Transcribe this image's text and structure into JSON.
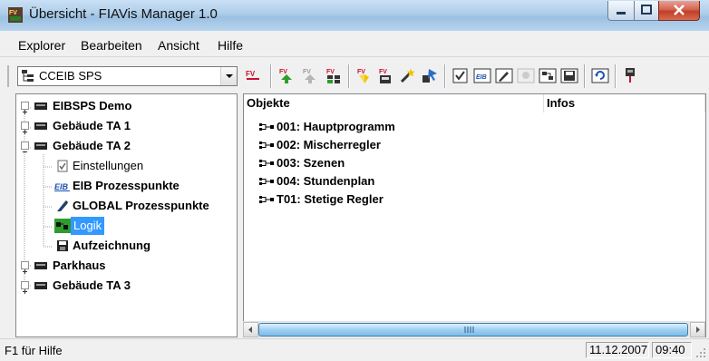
{
  "window": {
    "title": "Übersicht - FIAVis Manager 1.0"
  },
  "menu": {
    "items": [
      {
        "label": "Explorer"
      },
      {
        "label": "Bearbeiten"
      },
      {
        "label": "Ansicht"
      },
      {
        "label": "Hilfe"
      }
    ]
  },
  "toolbar": {
    "combo_value": "CCEIB SPS",
    "icons": [
      "fv-icon",
      "fv-green-arrow-icon",
      "fv-gray-arrow-icon",
      "fv-grid-icon",
      "fv-yellow-icon",
      "fv-pen-icon",
      "wand-icon",
      "pointer-icon",
      "checkbox-icon",
      "eib-icon",
      "pen-square-icon",
      "disabled-icon",
      "logic-block-icon",
      "disk-icon",
      "refresh-icon",
      "plug-icon"
    ]
  },
  "tree": {
    "nodes": [
      {
        "label": "EIBSPS Demo"
      },
      {
        "label": "Gebäude TA 1"
      },
      {
        "label": "Gebäude TA 2"
      },
      {
        "label": "Einstellungen"
      },
      {
        "label": "EIB Prozesspunkte"
      },
      {
        "label": "GLOBAL Prozesspunkte"
      },
      {
        "label": "Logik"
      },
      {
        "label": "Aufzeichnung"
      },
      {
        "label": "Parkhaus"
      },
      {
        "label": "Gebäude TA 3"
      }
    ]
  },
  "list": {
    "columns": [
      {
        "label": "Objekte"
      },
      {
        "label": "Infos"
      }
    ],
    "rows": [
      {
        "label": "001: Hauptprogramm"
      },
      {
        "label": "002: Mischerregler"
      },
      {
        "label": "003: Szenen"
      },
      {
        "label": "004: Stundenplan"
      },
      {
        "label": "T01: Stetige Regler"
      }
    ]
  },
  "status": {
    "help": "F1 für Hilfe",
    "date": "11.12.2007",
    "time": "09:40"
  },
  "colors": {
    "selection": "#3399ff",
    "titlebar": "#aecde9",
    "close_button": "#c13f27"
  }
}
